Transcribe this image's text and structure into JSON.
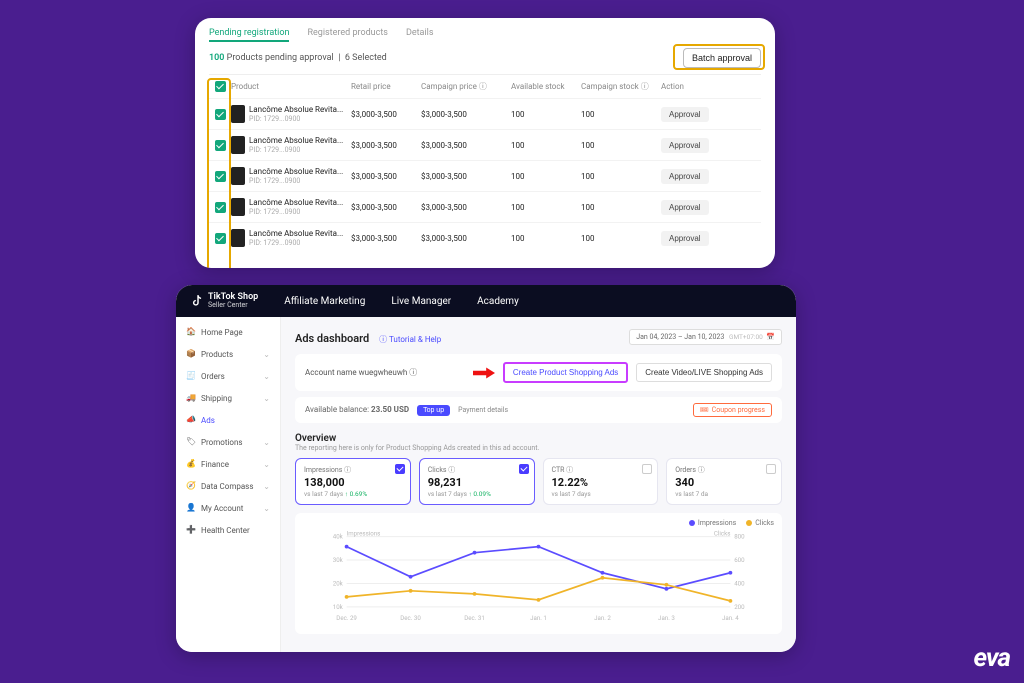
{
  "top_panel": {
    "tabs": [
      "Pending registration",
      "Registered products",
      "Details"
    ],
    "pending_count": "100",
    "pending_label": "Products pending approval",
    "selected_label": "6 Selected",
    "batch_button": "Batch approval",
    "columns": {
      "product": "Product",
      "retail": "Retail price",
      "campaign_price": "Campaign price ⓘ",
      "stock": "Available stock",
      "campaign_stock": "Campaign stock ⓘ",
      "action": "Action"
    },
    "rows": [
      {
        "name": "Lancôme Absolue Revita...",
        "pid": "PID: 1729...0900",
        "retail": "$3,000-3,500",
        "cprice": "$3,000-3,500",
        "stock": "100",
        "cstock": "100",
        "action": "Approval"
      },
      {
        "name": "Lancôme Absolue Revita...",
        "pid": "PID: 1729...0900",
        "retail": "$3,000-3,500",
        "cprice": "$3,000-3,500",
        "stock": "100",
        "cstock": "100",
        "action": "Approval"
      },
      {
        "name": "Lancôme Absolue Revita...",
        "pid": "PID: 1729...0900",
        "retail": "$3,000-3,500",
        "cprice": "$3,000-3,500",
        "stock": "100",
        "cstock": "100",
        "action": "Approval"
      },
      {
        "name": "Lancôme Absolue Revita...",
        "pid": "PID: 1729...0900",
        "retail": "$3,000-3,500",
        "cprice": "$3,000-3,500",
        "stock": "100",
        "cstock": "100",
        "action": "Approval"
      },
      {
        "name": "Lancôme Absolue Revita...",
        "pid": "PID: 1729...0900",
        "retail": "$3,000-3,500",
        "cprice": "$3,000-3,500",
        "stock": "100",
        "cstock": "100",
        "action": "Approval"
      }
    ]
  },
  "bottom_panel": {
    "brand_line1": "TikTok Shop",
    "brand_line2": "Seller Center",
    "top_nav": [
      "Affiliate Marketing",
      "Live Manager",
      "Academy"
    ],
    "sidebar": {
      "items": [
        {
          "label": "Home Page",
          "expandable": false
        },
        {
          "label": "Products",
          "expandable": true
        },
        {
          "label": "Orders",
          "expandable": true
        },
        {
          "label": "Shipping",
          "expandable": true
        },
        {
          "label": "Ads",
          "expandable": false,
          "active": true
        },
        {
          "label": "Promotions",
          "expandable": true
        },
        {
          "label": "Finance",
          "expandable": true
        },
        {
          "label": "Data Compass",
          "expandable": true
        },
        {
          "label": "My Account",
          "expandable": true
        },
        {
          "label": "Health Center",
          "expandable": false
        }
      ]
    },
    "dashboard": {
      "title": "Ads dashboard",
      "tutorial_link": "Tutorial & Help",
      "date_range": "Jan 04, 2023 – Jan 10, 2023",
      "date_tz": "GMT+07:00",
      "account_name_label": "Account name wuegwheuwh ⓘ",
      "create_primary": "Create Product Shopping Ads",
      "create_secondary": "Create Video/LIVE Shopping Ads",
      "balance_label": "Available balance:",
      "balance_value": "23.50 USD",
      "topup": "Top up",
      "payment_details": "Payment details",
      "coupon": "Coupon progress",
      "overview_title": "Overview",
      "overview_sub": "The reporting here is only for Product Shopping Ads created in this ad account.",
      "metrics": [
        {
          "label": "Impressions ⓘ",
          "value": "138,000",
          "sub": "vs last 7 days ",
          "delta": "↑ 0.69%",
          "checked": true,
          "hl": true
        },
        {
          "label": "Clicks ⓘ",
          "value": "98,231",
          "sub": "vs last 7 days ",
          "delta": "↑ 0.09%",
          "checked": true,
          "hl": true
        },
        {
          "label": "CTR ⓘ",
          "value": "12.22%",
          "sub": "vs last 7 days",
          "delta": "",
          "checked": false,
          "hl": false
        },
        {
          "label": "Orders ⓘ",
          "value": "340",
          "sub": "vs last 7 da",
          "delta": "",
          "checked": false,
          "hl": false
        }
      ],
      "legend": {
        "a": "Impressions",
        "b": "Clicks"
      }
    }
  },
  "chart_data": {
    "type": "line",
    "x": [
      "Dec. 29",
      "Dec. 30",
      "Dec. 31",
      "Jan. 1",
      "Jan. 2",
      "Jan. 3",
      "Jan. 4"
    ],
    "series": [
      {
        "name": "Impressions",
        "color": "#5b4cff",
        "axis": "left",
        "values": [
          40,
          25,
          37,
          40,
          27,
          19,
          27
        ]
      },
      {
        "name": "Clicks",
        "color": "#f0b429",
        "axis": "right",
        "values": [
          250,
          310,
          280,
          220,
          440,
          370,
          210
        ]
      }
    ],
    "left_axis_label": "Impressions",
    "right_axis_label": "Clicks",
    "left_ticks": [
      "40k",
      "30k",
      "20k",
      "10k"
    ],
    "right_ticks": [
      "800",
      "600",
      "400",
      "200"
    ]
  },
  "watermark": "eva"
}
